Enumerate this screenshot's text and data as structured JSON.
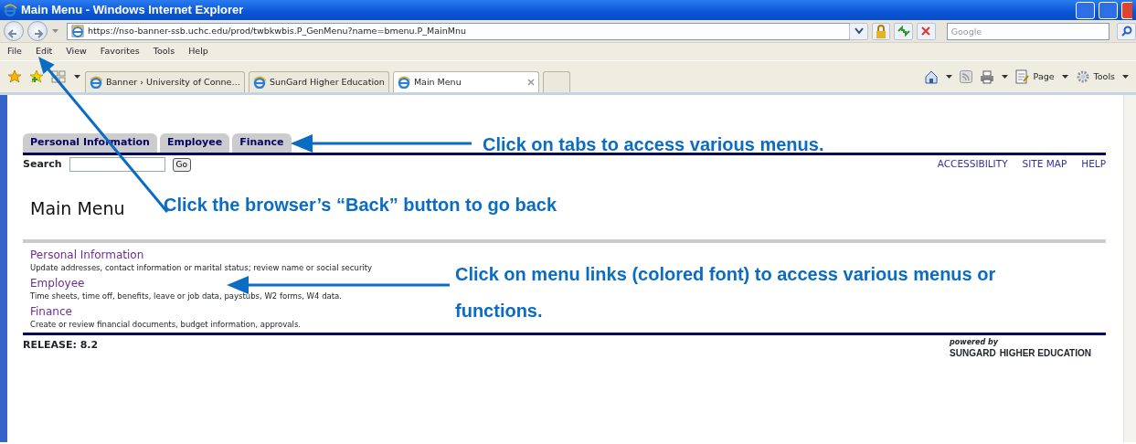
{
  "window": {
    "title": "Main Menu - Windows Internet Explorer"
  },
  "address_bar": {
    "url": "https://nso-banner-ssb.uchc.edu/prod/twbkwbis.P_GenMenu?name=bmenu.P_MainMnu"
  },
  "search_box": {
    "placeholder": "Google"
  },
  "menu_bar": [
    "File",
    "Edit",
    "View",
    "Favorites",
    "Tools",
    "Help"
  ],
  "browser_tabs": [
    {
      "label": "Banner › University of Conne…",
      "selected": false
    },
    {
      "label": "SunGard Higher Education",
      "selected": false
    },
    {
      "label": "Main Menu",
      "selected": true
    }
  ],
  "command_bar": [
    "Page",
    "Tools"
  ],
  "page": {
    "tabs": [
      "Personal Information",
      "Employee",
      "Finance"
    ],
    "search": {
      "label": "Search",
      "button": "Go"
    },
    "header_links": [
      "ACCESSIBILITY",
      "SITE MAP",
      "HELP"
    ],
    "heading": "Main Menu",
    "menu_items": [
      {
        "title": "Personal Information",
        "description": "Update addresses, contact information or marital status; review name or social security"
      },
      {
        "title": "Employee",
        "description": "Time sheets, time off, benefits, leave or job data, paystubs, W2 forms, W4 data."
      },
      {
        "title": "Finance",
        "description": "Create or review financial documents, budget information, approvals."
      }
    ],
    "release": "RELEASE: 8.2",
    "powered_by": "powered by",
    "brand": "SUNGARD",
    "brand_suffix": "HIGHER EDUCATION"
  },
  "annotations": [
    {
      "kind": "tabs",
      "text": "Click on tabs to access various menus."
    },
    {
      "kind": "back",
      "text": "Click the browser’s “Back” button to go back"
    },
    {
      "kind": "links",
      "text": "Click on menu links (colored font) to access various menus or  functions."
    }
  ]
}
